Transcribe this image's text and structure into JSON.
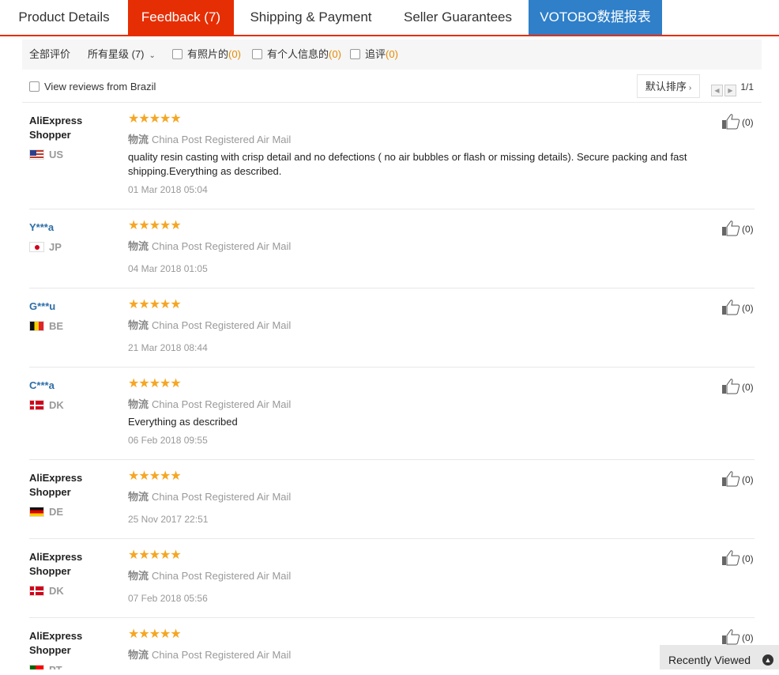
{
  "tabs": [
    {
      "label": "Product Details"
    },
    {
      "label": "Feedback (7)"
    },
    {
      "label": "Shipping & Payment"
    },
    {
      "label": "Seller Guarantees"
    },
    {
      "label": "VOTOBO数据报表"
    }
  ],
  "filters": {
    "all": "全部评价",
    "stars_label": "所有星级 (7)",
    "with_photos": "有照片的",
    "with_photos_count": "(0)",
    "with_personal_info": "有个人信息的",
    "with_personal_info_count": "(0)",
    "additional": "追评",
    "additional_count": "(0)"
  },
  "subbar": {
    "brazil_label": "View reviews from Brazil",
    "sort_label": "默认排序",
    "page_indicator": "1/1"
  },
  "reviews": [
    {
      "user": "AliExpress Shopper",
      "country": "US",
      "stars": "★★★★★",
      "logistics_label": "物流",
      "logistics": "China Post Registered Air Mail",
      "text": "quality resin casting with crisp detail and no defections ( no air bubbles or flash or missing details). Secure packing and fast shipping.Everything as described.",
      "date": "01 Mar 2018 05:04",
      "likes": "(0)"
    },
    {
      "user": "Y***a",
      "country": "JP",
      "stars": "★★★★★",
      "logistics_label": "物流",
      "logistics": "China Post Registered Air Mail",
      "text": "",
      "date": "04 Mar 2018 01:05",
      "likes": "(0)"
    },
    {
      "user": "G***u",
      "country": "BE",
      "stars": "★★★★★",
      "logistics_label": "物流",
      "logistics": "China Post Registered Air Mail",
      "text": "",
      "date": "21 Mar 2018 08:44",
      "likes": "(0)"
    },
    {
      "user": "C***a",
      "country": "DK",
      "stars": "★★★★★",
      "logistics_label": "物流",
      "logistics": "China Post Registered Air Mail",
      "text": "Everything as described",
      "date": "06 Feb 2018 09:55",
      "likes": "(0)"
    },
    {
      "user": "AliExpress Shopper",
      "country": "DE",
      "stars": "★★★★★",
      "logistics_label": "物流",
      "logistics": "China Post Registered Air Mail",
      "text": "",
      "date": "25 Nov 2017 22:51",
      "likes": "(0)"
    },
    {
      "user": "AliExpress Shopper",
      "country": "DK",
      "stars": "★★★★★",
      "logistics_label": "物流",
      "logistics": "China Post Registered Air Mail",
      "text": "",
      "date": "07 Feb 2018 05:56",
      "likes": "(0)"
    },
    {
      "user": "AliExpress Shopper",
      "country": "PT",
      "stars": "★★★★★",
      "logistics_label": "物流",
      "logistics": "China Post Registered Air Mail",
      "text": "",
      "date": "",
      "likes": "(0)"
    }
  ],
  "recently_viewed": {
    "label": "Recently Viewed"
  },
  "colors": {
    "accent": "#e62e04",
    "votobo": "#2f7fc9",
    "star": "#f5a623",
    "username_masked": "#2e6ea6"
  }
}
